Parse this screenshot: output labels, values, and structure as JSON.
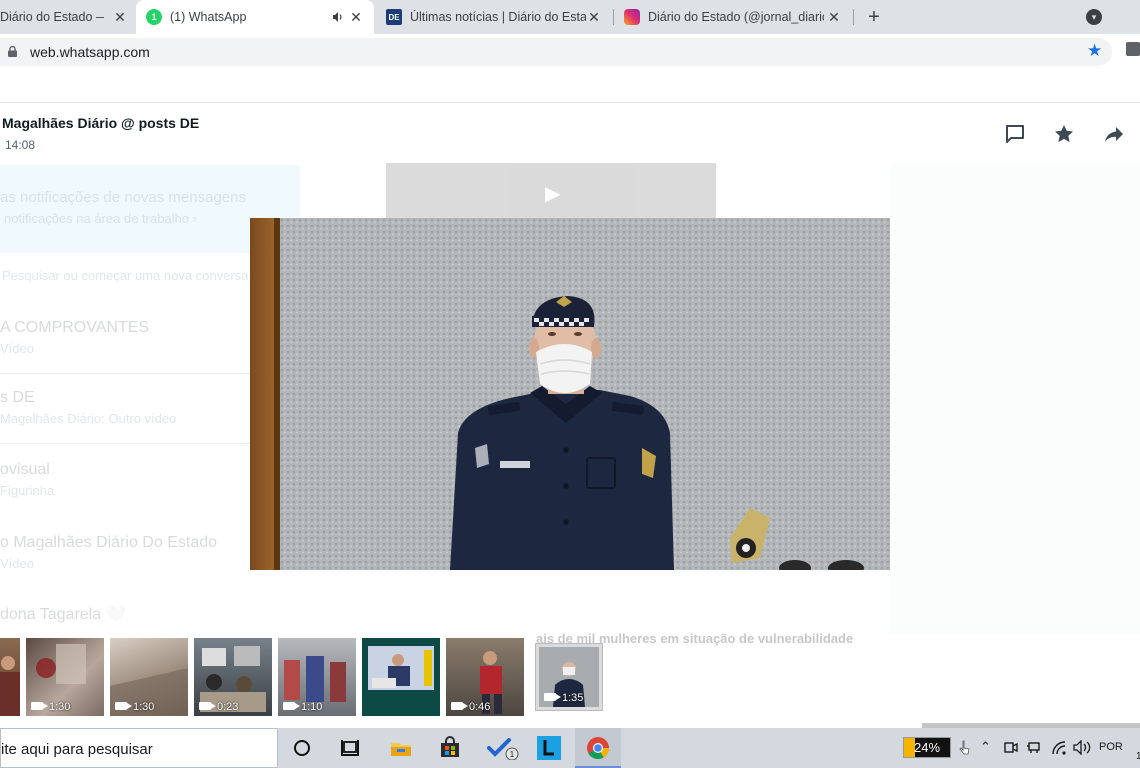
{
  "browser": {
    "tabs": [
      {
        "title": "Diário do Estado —",
        "favicon": "generic-page-icon",
        "active": false
      },
      {
        "title": "(1) WhatsApp",
        "favicon": "whatsapp-icon",
        "badge": "1",
        "audio": true,
        "active": true
      },
      {
        "title": "Últimas notícias | Diário do Estad",
        "favicon": "de-logo-icon",
        "favicon_text": "DE",
        "active": false
      },
      {
        "title": "Diário do Estado (@jornal_diarioc",
        "favicon": "instagram-icon",
        "active": false
      }
    ],
    "new_tab_label": "+",
    "url": "web.whatsapp.com"
  },
  "viewer": {
    "sender": "Magalhães Diário @ posts DE",
    "time": "14:08",
    "header_icons": [
      "reply-message-icon",
      "star-icon",
      "forward-icon"
    ],
    "thumbnails": [
      {
        "duration": "",
        "video": false
      },
      {
        "duration": "1:30",
        "video": true
      },
      {
        "duration": "1:30",
        "video": true
      },
      {
        "duration": "0:23",
        "video": true
      },
      {
        "duration": "1:10",
        "video": true
      },
      {
        "duration": "",
        "video": false
      },
      {
        "duration": "0:46",
        "video": true
      },
      {
        "duration": "1:35",
        "video": true,
        "selected": true
      }
    ]
  },
  "background": {
    "banner_title": "as notificações de novas mensagens",
    "banner_sub": "notificações na área de trabalho ›",
    "search_hint": "Pesquisar ou começar uma nova conversa",
    "chats": [
      {
        "title": "A COMPROVANTES",
        "subtitle": "Vídeo"
      },
      {
        "title": "s DE",
        "subtitle": "Magalhães Diário: Outro vídeo"
      },
      {
        "title": "ovisual",
        "subtitle": "Figurinha"
      },
      {
        "title": "o Magalhães Diário Do Estado",
        "subtitle": "Vídeo"
      },
      {
        "title": "dona Tagarela 🤍",
        "subtitle": ""
      }
    ],
    "headline": "ais de mil mulheres em situação de vulnerabilidade"
  },
  "taskbar": {
    "search_text": "ite aqui para pesquisar",
    "battery": "24%",
    "battery_level": 0.24,
    "language": "POR",
    "clock": "1"
  }
}
